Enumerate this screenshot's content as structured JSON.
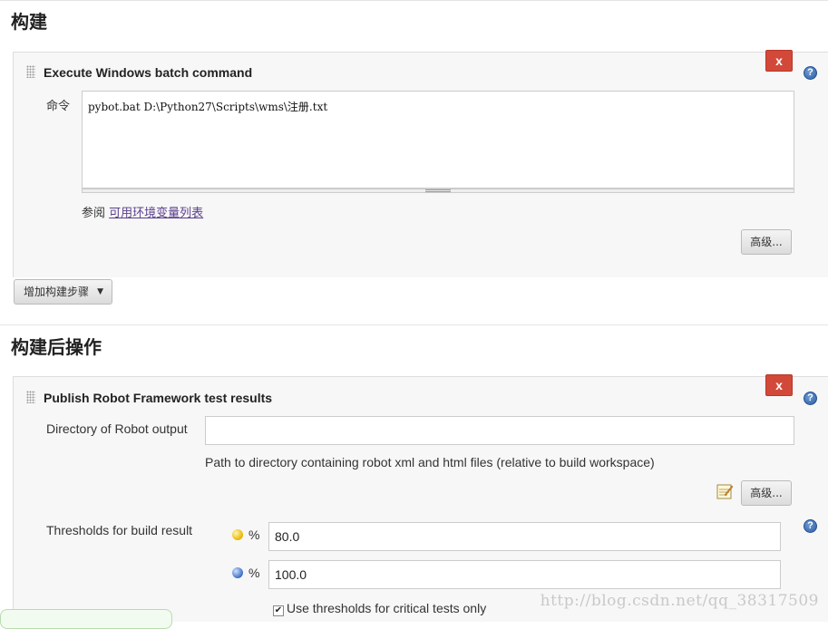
{
  "build_section": {
    "title": "构建",
    "step": {
      "title": "Execute Windows batch command",
      "delete_label": "x",
      "help_label": "?",
      "command_label": "命令",
      "command_value": "pybot.bat D:\\Python27\\Scripts\\wms\\注册.txt",
      "see_prefix": "参阅",
      "env_link": "可用环境变量列表",
      "advanced_label": "高级..."
    },
    "add_step_label": "增加构建步骤"
  },
  "post_build_section": {
    "title": "构建后操作",
    "step": {
      "title": "Publish Robot Framework test results",
      "delete_label": "x",
      "help_label": "?",
      "dir_label": "Directory of Robot output",
      "dir_value": "",
      "dir_hint": "Path to directory containing robot xml and html files (relative to build workspace)",
      "advanced_label": "高级...",
      "thresholds_label": "Thresholds for build result",
      "thresholds_help": "?",
      "unstable_pct_label": "%",
      "unstable_value": "80.0",
      "pass_pct_label": "%",
      "pass_value": "100.0",
      "critical_only_label": "Use thresholds for critical tests only",
      "critical_only_checked": true
    }
  },
  "watermark": "http://blog.csdn.net/qq_38317509",
  "colors": {
    "delete_red": "#d24939",
    "help_blue": "#2c5ea8",
    "panel_bg": "#f7f7f7",
    "link_purple": "#5a3e8c"
  }
}
